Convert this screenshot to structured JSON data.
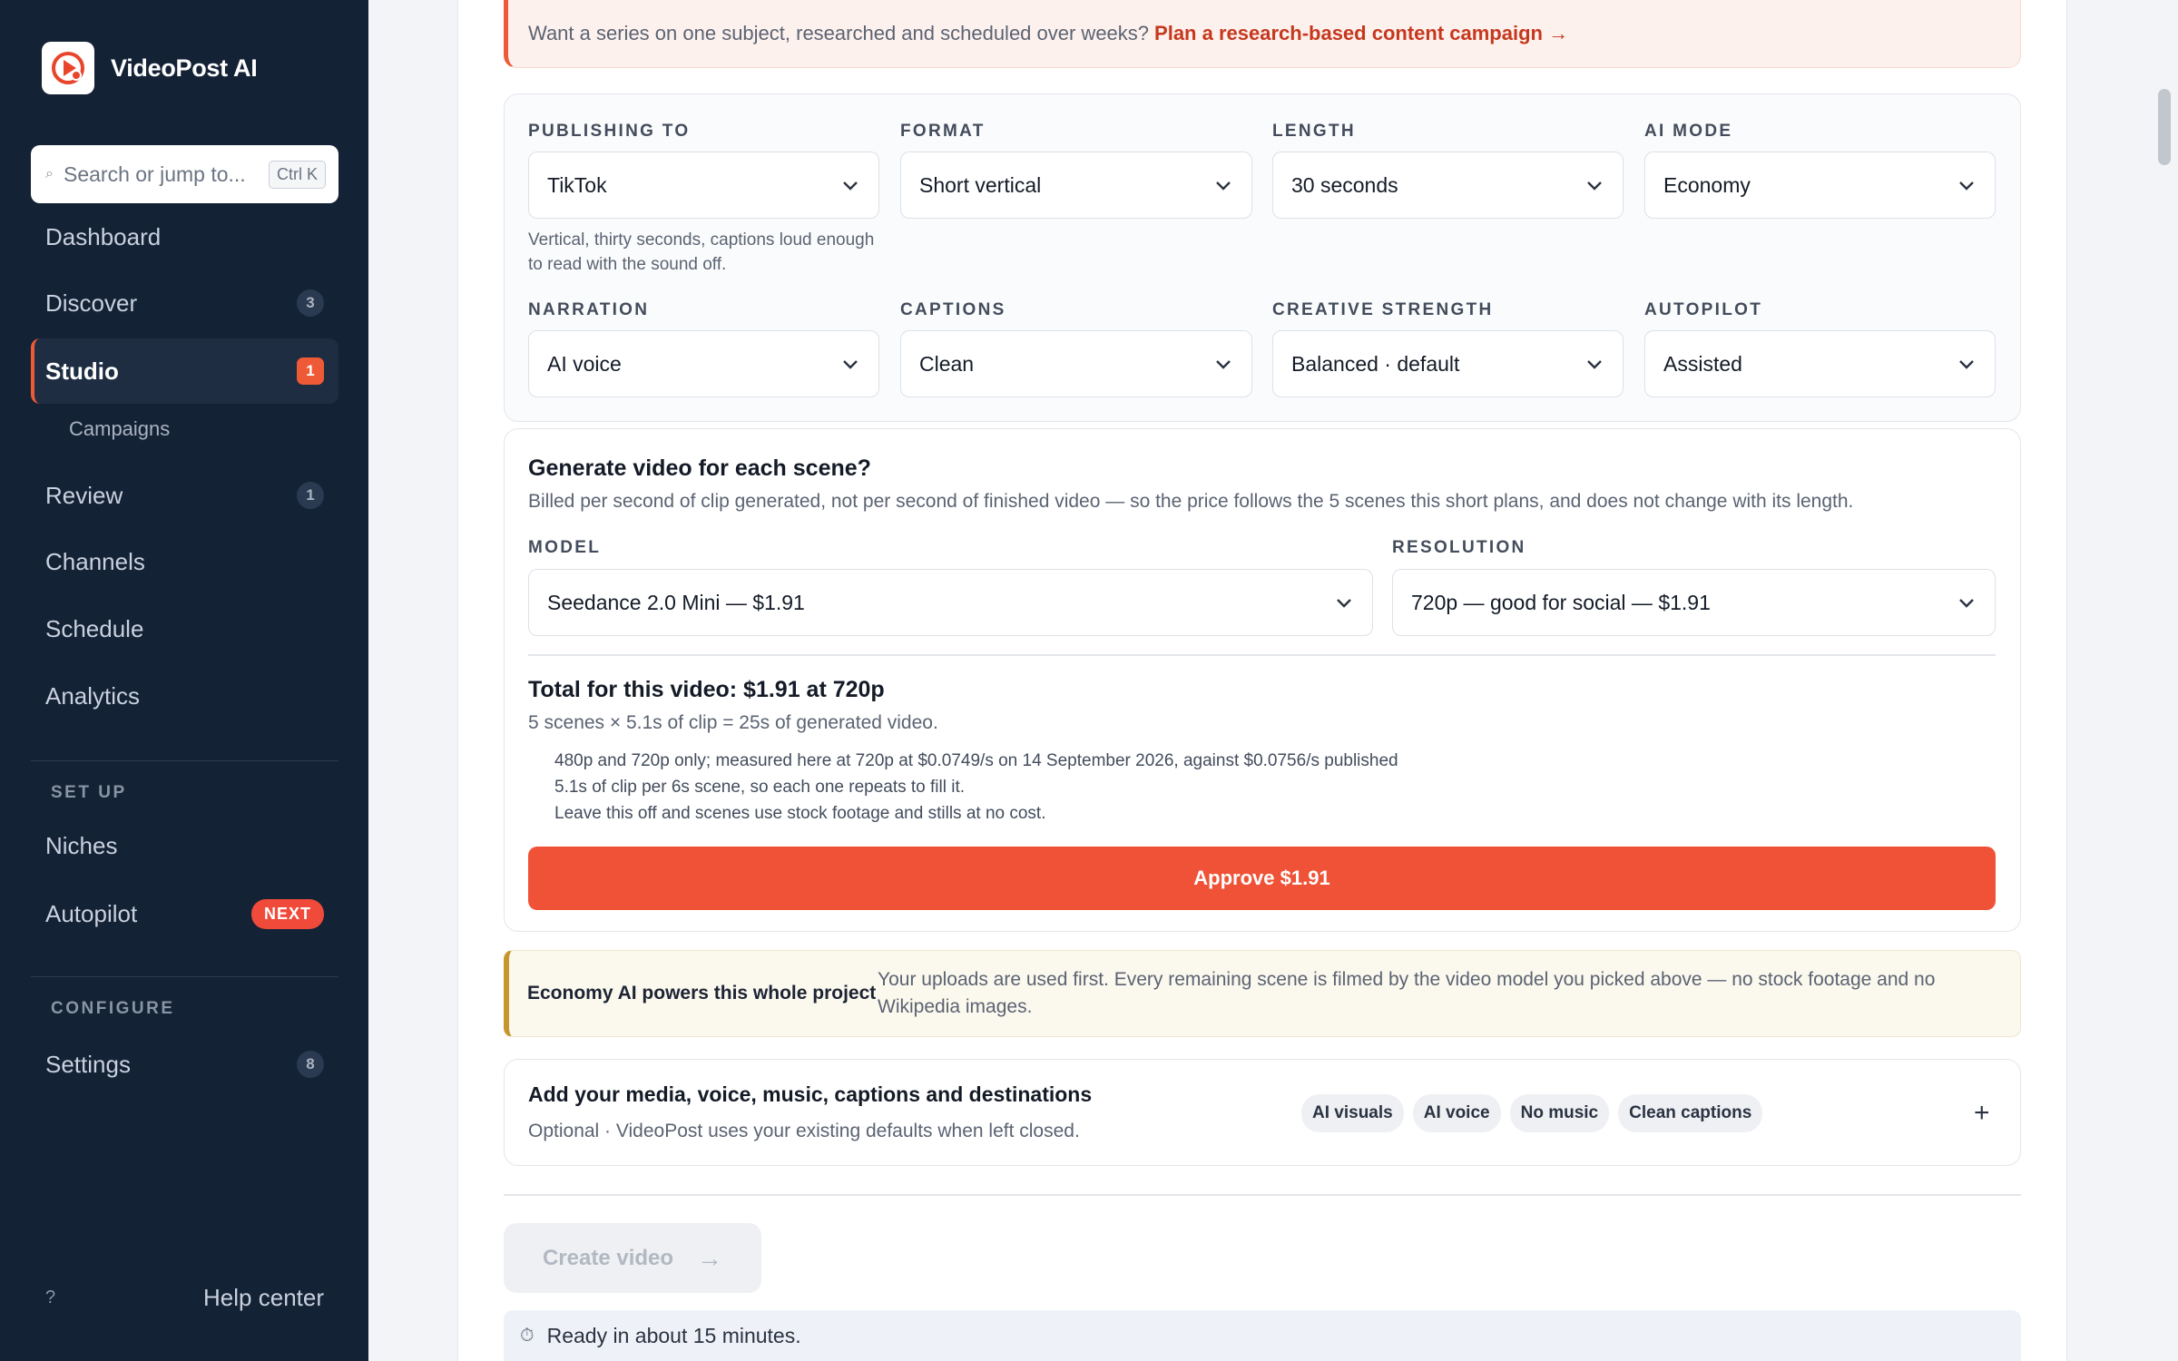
{
  "app": {
    "name": "VideoPost AI",
    "logo_icon": "play-logo-icon",
    "brand_color": "#ef5a36"
  },
  "sidebar": {
    "search_placeholder": "Search or jump to...",
    "search_shortcut": "Ctrl K",
    "items": [
      {
        "label": "Dashboard",
        "count": ""
      },
      {
        "label": "Discover",
        "count": "3"
      },
      {
        "label": "Studio",
        "count": "1",
        "active": true
      },
      {
        "label": "Review",
        "count": "1"
      },
      {
        "label": "Channels",
        "count": ""
      },
      {
        "label": "Schedule",
        "count": ""
      },
      {
        "label": "Analytics",
        "count": ""
      }
    ],
    "sub_item": "Campaigns",
    "setup_label": "SET UP",
    "setup_items": [
      {
        "label": "Niches"
      },
      {
        "label": "Autopilot",
        "badge": "NEXT"
      }
    ],
    "configure_label": "CONFIGURE",
    "configure_items": [
      {
        "label": "Settings",
        "count": "8"
      }
    ],
    "help_icon": "?",
    "help_label": "Help center"
  },
  "tip": {
    "text": "Want a series on one subject, researched and scheduled over weeks?",
    "link": "Plan a research-based content campaign →"
  },
  "settings": {
    "publishing_to": {
      "label": "PUBLISHING TO",
      "value": "TikTok",
      "hint": "Vertical, thirty seconds, captions loud enough to read with the sound off."
    },
    "format": {
      "label": "FORMAT",
      "value": "Short vertical"
    },
    "length": {
      "label": "LENGTH",
      "value": "30 seconds"
    },
    "ai_mode": {
      "label": "AI MODE",
      "value": "Economy"
    },
    "narration": {
      "label": "NARRATION",
      "value": "AI voice"
    },
    "captions": {
      "label": "CAPTIONS",
      "value": "Clean"
    },
    "creative_strength": {
      "label": "CREATIVE STRENGTH",
      "value": "Balanced · default"
    },
    "autopilot": {
      "label": "AUTOPILOT",
      "value": "Assisted"
    }
  },
  "generate": {
    "title": "Generate video for each scene?",
    "subtitle": "Billed per second of clip generated, not per second of finished video — so the price follows the 5 scenes this short plans, and does not change with its length.",
    "model_label": "MODEL",
    "model_value": "Seedance 2.0 Mini — $1.91",
    "resolution_label": "RESOLUTION",
    "resolution_value": "720p — good for social — $1.91",
    "total": "Total for this video: $1.91 at 720p",
    "breakdown": "5 scenes × 5.1s of clip = 25s of generated video.",
    "notes": [
      "480p and 720p only; measured here at 720p at $0.0749/s on 14 September 2026, against $0.0756/s published",
      "5.1s of clip per 6s scene, so each one repeats to fill it.",
      "Leave this off and scenes use stock footage and stills at no cost."
    ],
    "approve_label": "Approve $1.91"
  },
  "economy": {
    "title": "Economy AI powers this whole project",
    "text": "Your uploads are used first. Every remaining scene is filmed by the video model you picked above — no stock footage and no Wikipedia images."
  },
  "media": {
    "title": "Add your media, voice, music, captions and destinations",
    "subtitle": "Optional · VideoPost uses your existing defaults when left closed.",
    "chips": [
      "AI visuals",
      "AI voice",
      "No music",
      "Clean captions"
    ],
    "expand": "+"
  },
  "create": {
    "label": "Create video",
    "arrow": "→"
  },
  "ready": {
    "icon": "⏱",
    "text": "Ready in about 15 minutes."
  }
}
